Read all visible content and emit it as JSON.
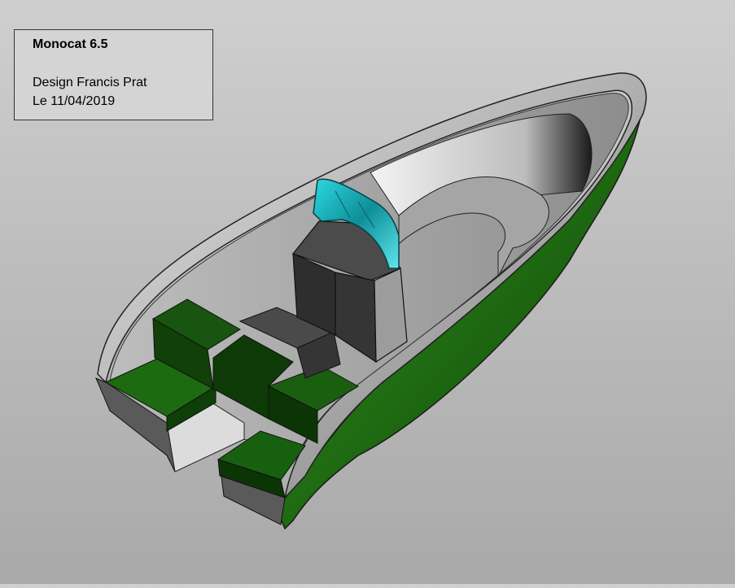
{
  "info_box": {
    "title": "Monocat 6.5",
    "designer": "Design Francis Prat",
    "date": "Le 11/04/2019"
  },
  "model": {
    "hull_color": "#1f6b12",
    "deck_color": "#9a9a9a",
    "windshield_color": "#22c6d0",
    "seat_color": "#1d4a10",
    "console_color": "#3c3c3c"
  }
}
